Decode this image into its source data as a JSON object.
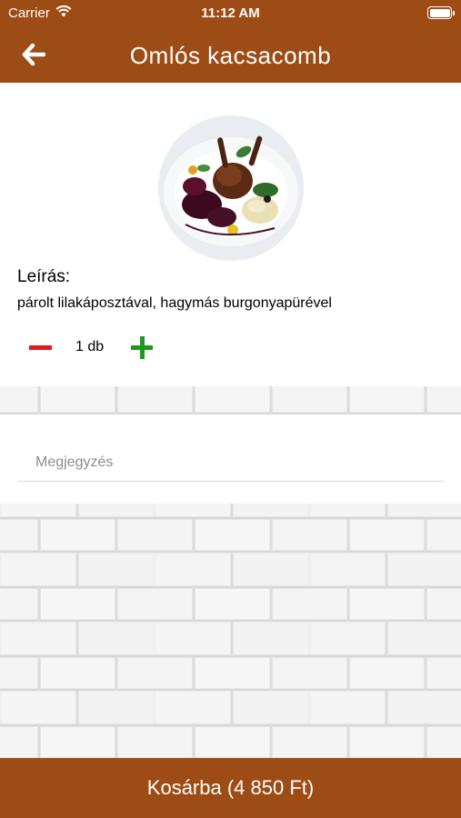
{
  "status_bar": {
    "carrier": "Carrier",
    "time": "11:12 AM"
  },
  "header": {
    "title": "Omlós kacsacomb",
    "back_icon": "arrow-left-icon"
  },
  "product": {
    "image_icon": "dish-photo",
    "description_label": "Leírás:",
    "description": "párolt lilakáposztával, hagymás burgonyapürével",
    "quantity_text": "1 db"
  },
  "note": {
    "placeholder": "Megjegyzés",
    "value": ""
  },
  "footer": {
    "cart_label": "Kosárba (4 850 Ft)"
  },
  "colors": {
    "brand": "#9e4c16",
    "minus": "#e01a1a",
    "plus": "#1d9a1d"
  }
}
